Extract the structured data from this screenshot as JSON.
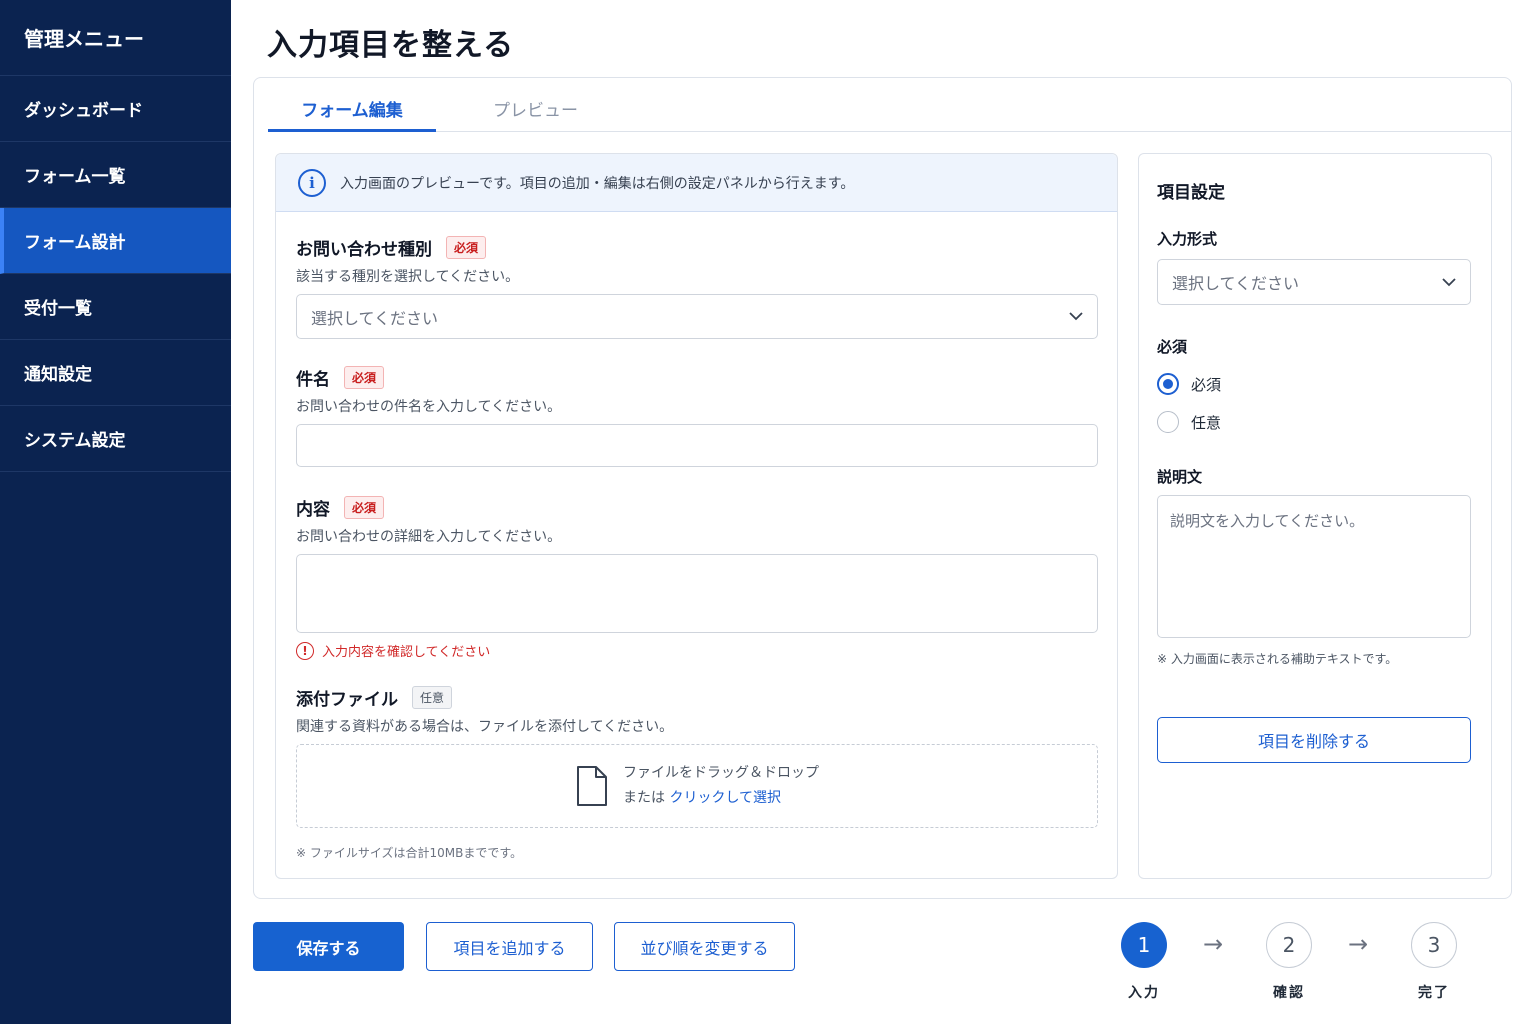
{
  "sidebar": {
    "title": "管理メニュー",
    "items": [
      {
        "label": "ダッシュボード"
      },
      {
        "label": "フォーム一覧"
      },
      {
        "label": "フォーム設計"
      },
      {
        "label": "受付一覧"
      },
      {
        "label": "通知設定"
      },
      {
        "label": "システム設定"
      }
    ],
    "active_index": 2
  },
  "page": {
    "title": "入力項目を整える"
  },
  "tabs": {
    "edit": "フォーム編集",
    "preview": "プレビュー"
  },
  "info": {
    "icon": "info-icon",
    "text": "入力画面のプレビューです。項目の追加・編集は右側の設定パネルから行えます。"
  },
  "fields": {
    "inquiry_type": {
      "label": "お問い合わせ種別",
      "badge": "必須",
      "description": "該当する種別を選択してください。",
      "placeholder": "選択してください"
    },
    "subject": {
      "label": "件名",
      "badge": "必須",
      "description": "お問い合わせの件名を入力してください。",
      "value": ""
    },
    "content": {
      "label": "内容",
      "badge": "必須",
      "description": "お問い合わせの詳細を入力してください。",
      "value": "",
      "error": "入力内容を確認してください"
    },
    "attachment": {
      "label": "添付ファイル",
      "badge": "任意",
      "description": "関連する資料がある場合は、ファイルを添付してください。",
      "drop_text": "ファイルをドラッグ＆ドロップ",
      "or_text": "または",
      "link_text": "クリックして選択",
      "note": "※ ファイルサイズは合計10MBまでです。"
    }
  },
  "settings": {
    "title": "項目設定",
    "input_type_label": "入力形式",
    "input_type_placeholder": "選択してください",
    "required_label": "必須",
    "required_options": [
      "必須",
      "任意"
    ],
    "required_selected": 0,
    "description_label": "説明文",
    "description_placeholder": "説明文を入力してください。",
    "description_note": "※ 入力画面に表示される補助テキストです。",
    "delete_button": "項目を削除する"
  },
  "actions": {
    "save": "保存する",
    "add_item": "項目を追加する",
    "reorder": "並び順を変更する"
  },
  "stepper": {
    "steps": [
      {
        "number": "1",
        "label": "入力"
      },
      {
        "number": "2",
        "label": "確認"
      },
      {
        "number": "3",
        "label": "完了"
      }
    ],
    "current": 0
  },
  "colors": {
    "sidebar_bg": "#0b2350",
    "accent": "#1762d0",
    "error": "#d12929"
  }
}
